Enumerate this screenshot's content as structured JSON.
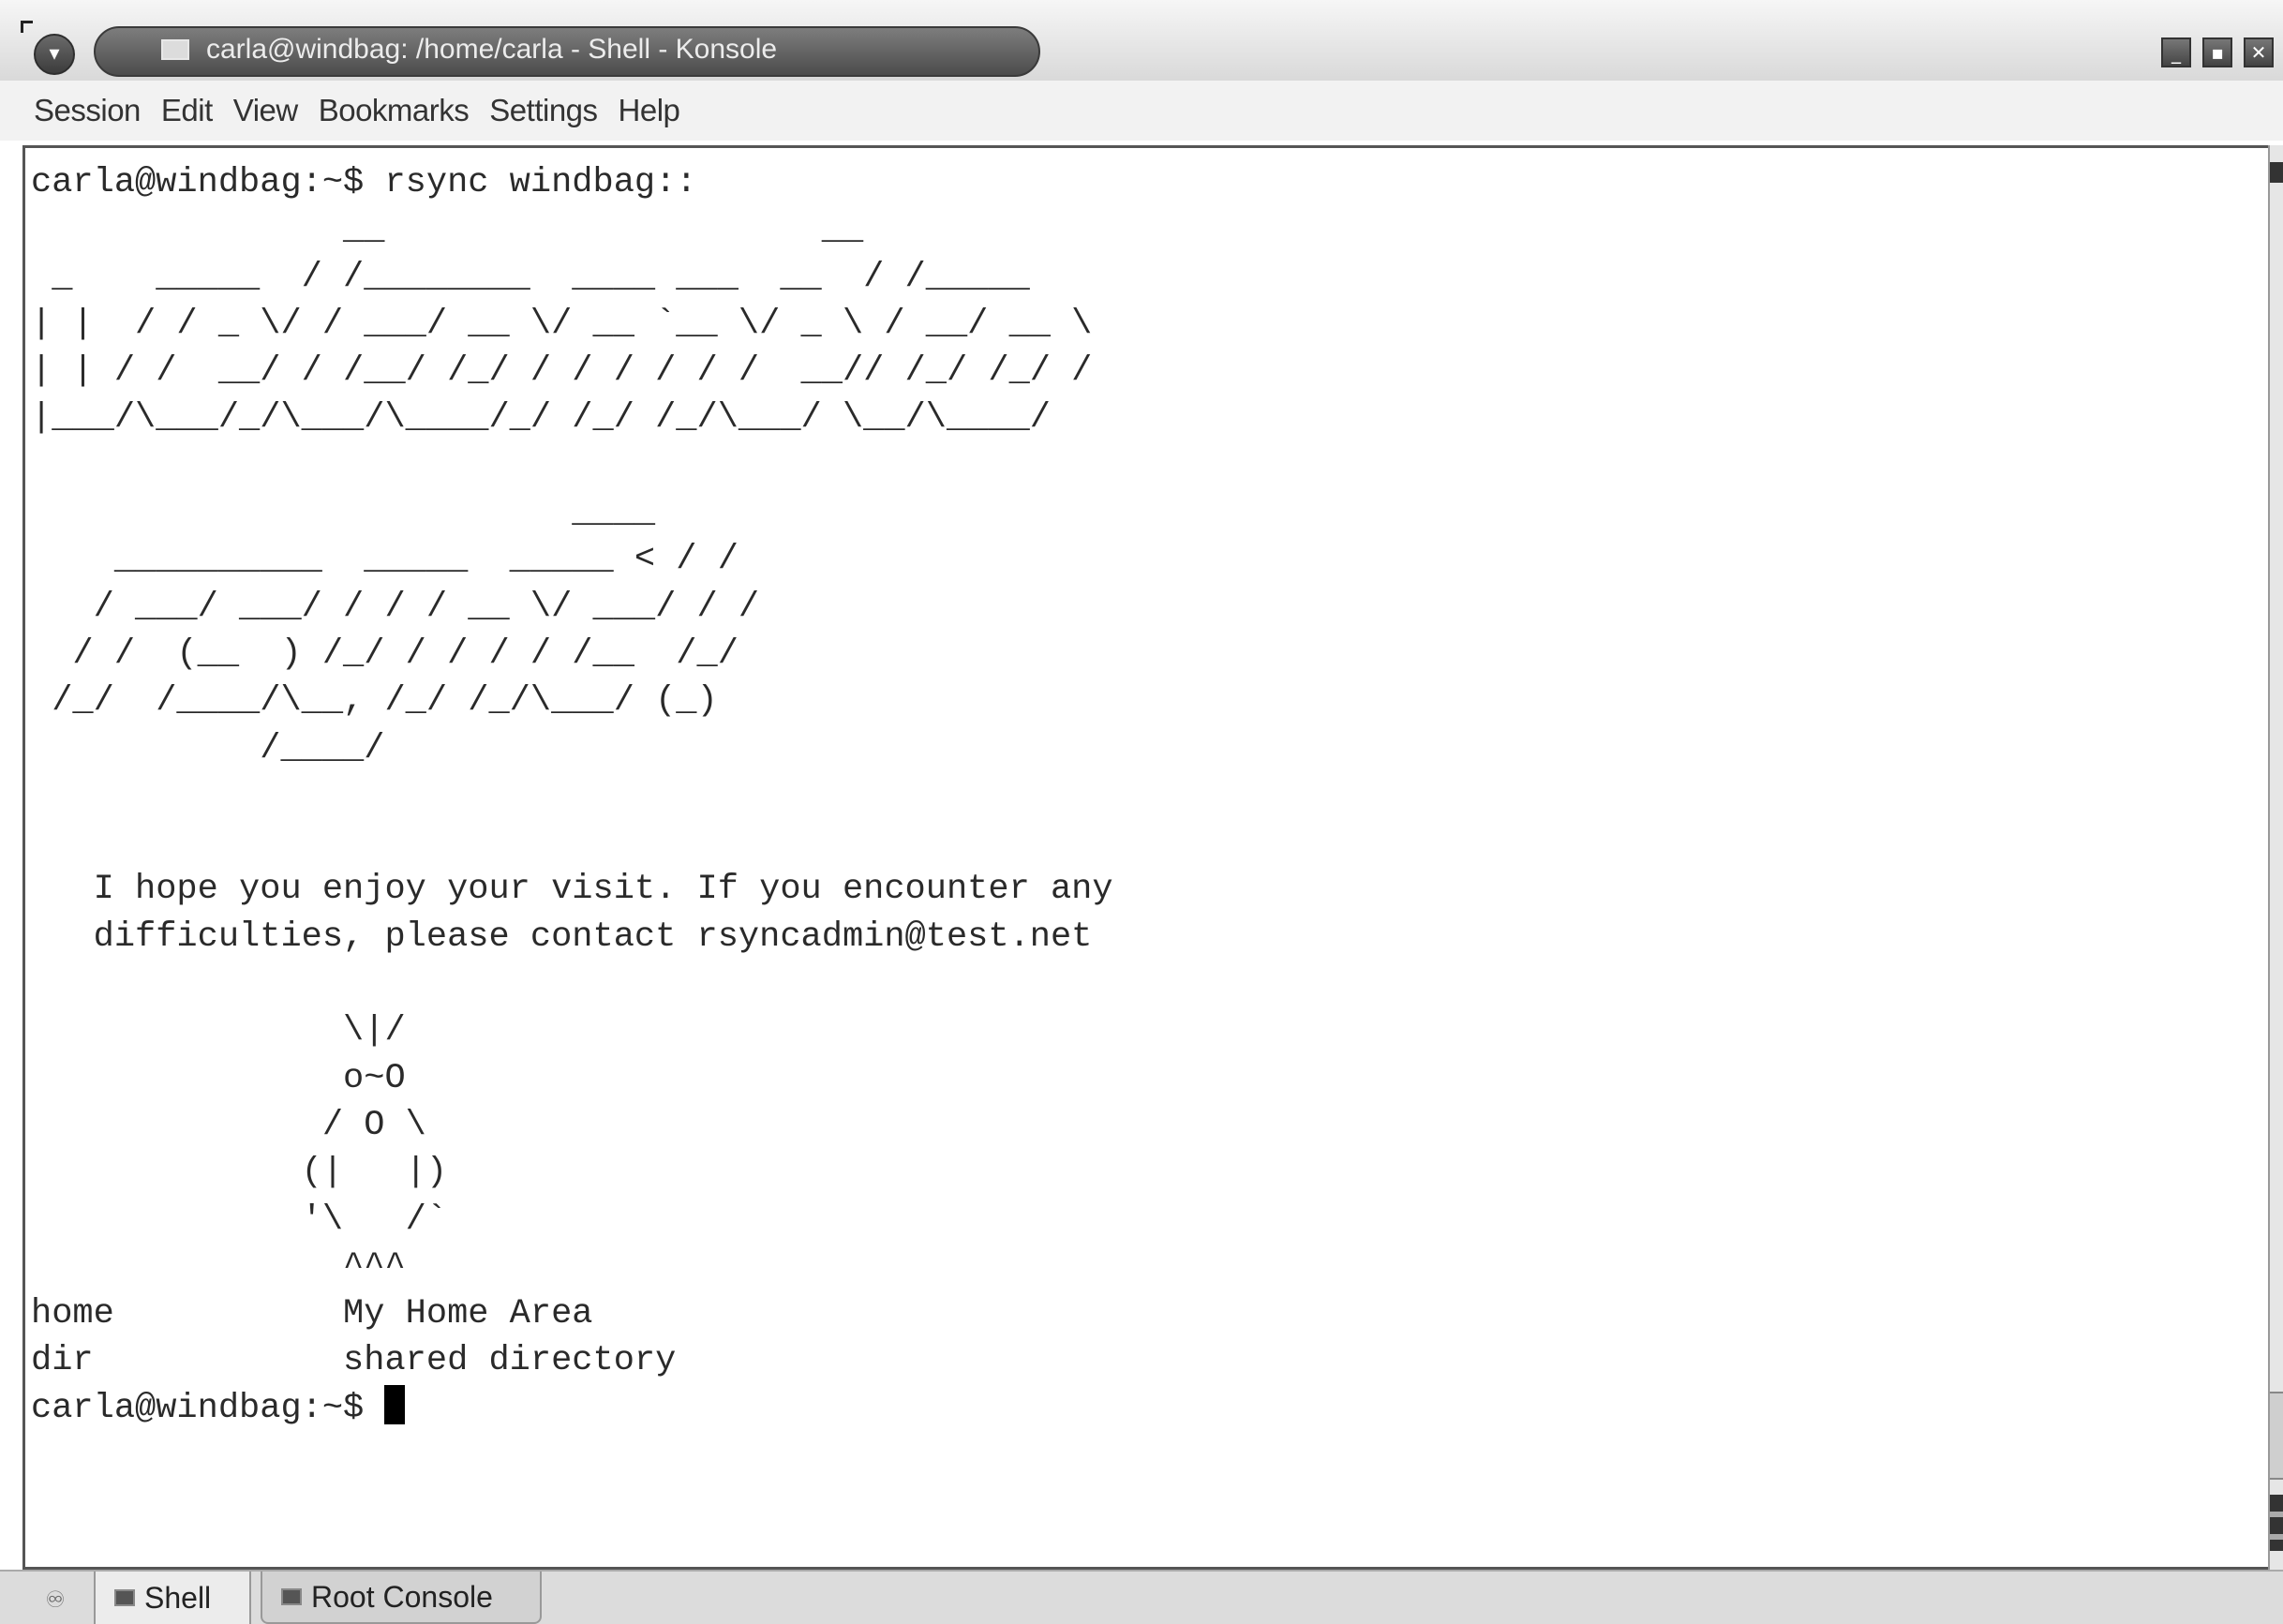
{
  "window": {
    "title": "carla@windbag: /home/carla - Shell - Konsole",
    "controls": {
      "menu": "▾",
      "minimize": "_",
      "maximize": "▪",
      "close": "✕"
    }
  },
  "menubar": {
    "items": [
      "Session",
      "Edit",
      "View",
      "Bookmarks",
      "Settings",
      "Help"
    ]
  },
  "terminal": {
    "output": "carla@windbag:~$ rsync windbag::\n               __                     __\n _    _____  / /________  ____ ___  __  / /_____\n| |  / / _ \\/ / ___/ __ \\/ __ `__ \\/ _ \\ / __/ __ \\\n| | / /  __/ / /__/ /_/ / / / / / /  __// /_/ /_/ /\n|___/\\___/_/\\___/\\____/_/ /_/ /_/\\___/ \\__/\\____/\n\n                          ____\n    __________  _____  _____ < / /\n   / ___/ ___/ / / / __ \\/ ___/ / /\n  / /  (__  ) /_/ / / / / /__  /_/\n /_/  /____/\\__, /_/ /_/\\___/ (_)\n           /____/\n\n\n   I hope you enjoy your visit. If you encounter any\n   difficulties, please contact rsyncadmin@test.net\n\n               \\|/\n               o~O\n              / O \\\n             (|   |)\n             '\\   /`\n               ^^^\nhome           My Home Area\ndir            shared directory",
    "prompt": "carla@windbag:~$ "
  },
  "tabbar": {
    "new_tab_icon": "new-session-icon",
    "tabs": [
      {
        "label": "Shell",
        "active": true
      },
      {
        "label": "Root Console",
        "active": false
      }
    ]
  }
}
